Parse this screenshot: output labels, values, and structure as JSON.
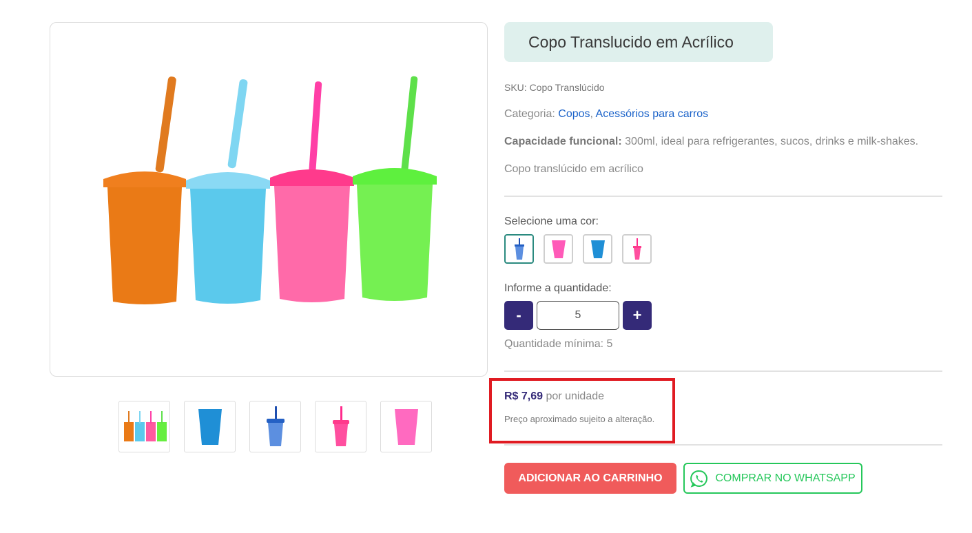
{
  "product": {
    "title": "Copo Translucido em Acrílico",
    "sku_label": "SKU: Copo Translúcido",
    "category_label": "Categoria: ",
    "categories": [
      "Copos",
      "Acessórios para carros"
    ],
    "category_separator": ", ",
    "capacity_label": "Capacidade funcional:",
    "capacity_text": " 300ml, ideal para refrigerantes, sucos, drinks e milk-shakes.",
    "description": "Copo translúcido em acrílico"
  },
  "gallery": {
    "main_image_icon": "four-cups-image",
    "thumbnails": [
      "four-cups-thumb",
      "blue-cup-thumb",
      "blue-cup-straw-thumb",
      "pink-cup-straw-thumb",
      "pink-cup-thumb"
    ]
  },
  "color_selector": {
    "label": "Selecione uma cor:",
    "options": [
      "blue-cup-straw",
      "pink-cup",
      "blue-cup",
      "pink-cup-straw"
    ],
    "selected_index": 0
  },
  "quantity": {
    "label": "Informe a quantidade:",
    "minus": "-",
    "plus": "+",
    "value": "5",
    "minimum_text": "Quantidade mínima: 5"
  },
  "price": {
    "amount": "R$ 7,69",
    "unit": " por unidade",
    "note": "Preço aproximado sujeito a alteração."
  },
  "actions": {
    "add_to_cart": "ADICIONAR AO CARRINHO",
    "whatsapp": "COMPRAR NO WHATSAPP"
  },
  "colors": {
    "accent_dark": "#342a78",
    "cart_red": "#f05b5b",
    "whatsapp_green": "#25c75a",
    "title_bg": "#dff0ed",
    "highlight_red": "#e01b22",
    "link_blue": "#1a62c9"
  }
}
